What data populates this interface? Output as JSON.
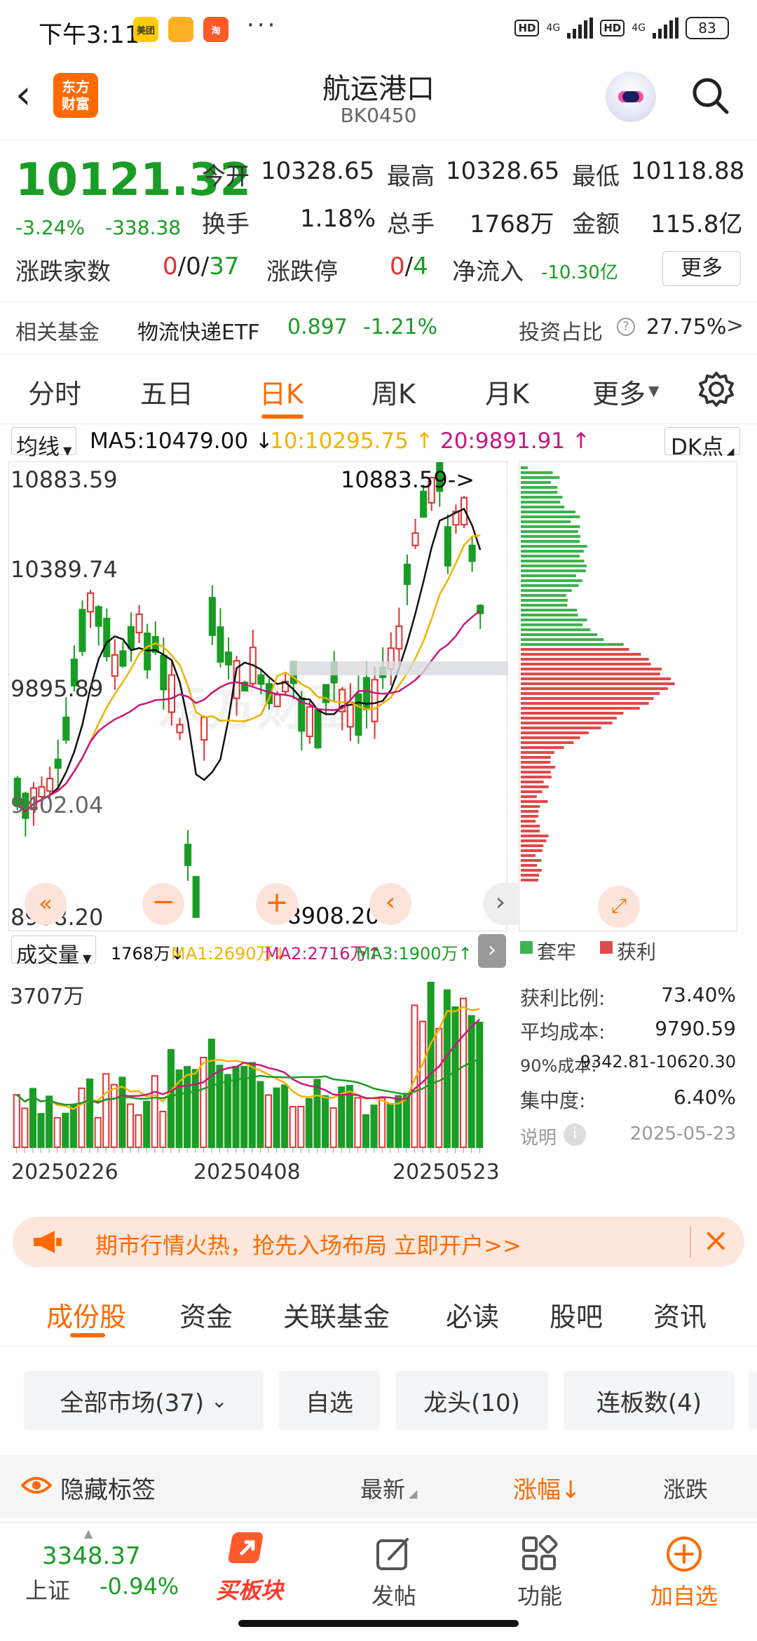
{
  "status": {
    "time": "下午3:11",
    "apps": [
      "美团",
      "",
      "淘"
    ],
    "net1": "4G",
    "net2": "4G",
    "hd": "HD",
    "battery": "83"
  },
  "header": {
    "title": "航运港口",
    "code": "BK0450",
    "logo_text": "东方财富"
  },
  "quote": {
    "price": "10121.32",
    "change_pct": "-3.24%",
    "change": "-338.38",
    "open_label": "今开",
    "open": "10328.65",
    "high_label": "最高",
    "high": "10328.65",
    "low_label": "最低",
    "low": "10118.88",
    "turnover_label": "换手",
    "turnover": "1.18%",
    "volume_label": "总手",
    "volume": "1768万",
    "amount_label": "金额",
    "amount": "115.8亿",
    "updown_label": "涨跌家数",
    "up": "0",
    "flat": "0",
    "down": "37",
    "limit_label": "涨跌停",
    "limit_up": "0",
    "limit_down": "4",
    "inflow_label": "净流入",
    "inflow": "-10.30亿",
    "more": "更多"
  },
  "fund": {
    "label": "相关基金",
    "name": "物流快递ETF",
    "price": "0.897",
    "pct": "-1.21%",
    "ratio_label": "投资占比",
    "ratio": "27.75%"
  },
  "period_tabs": [
    "分时",
    "五日",
    "日K",
    "周K",
    "月K",
    "更多"
  ],
  "ma": {
    "selector": "均线",
    "ma5": "MA5:10479.00",
    "ma5_arrow": "↓",
    "ma10": "10:10295.75",
    "ma10_arrow": "↑",
    "ma20": "20:9891.91",
    "ma20_arrow": "↑",
    "dk": "DK点"
  },
  "kchart": {
    "y_labels": [
      "10883.59",
      "10389.74",
      "9895.89",
      "9402.04",
      "8908.20"
    ],
    "max_note": "10883.59->",
    "min_note": "<-8908.20"
  },
  "vol": {
    "selector": "成交量",
    "v": "1768万",
    "v_arrow": "↓",
    "ma1": "MA1:2690万",
    "ma1_arrow": "↓",
    "ma2": "MA2:2716万",
    "ma2_arrow": "↑",
    "ma3": "MA3:1900万",
    "ma3_arrow": "↑",
    "ymax": "3707万",
    "dates": [
      "20250226",
      "20250408",
      "20250523"
    ]
  },
  "chip": {
    "legend_trapped": "套牢",
    "legend_profit": "获利",
    "profit_ratio_label": "获利比例:",
    "profit_ratio": "73.40%",
    "avg_cost_label": "平均成本:",
    "avg_cost": "9790.59",
    "cost90_label": "90%成本:",
    "cost90": "9342.81-10620.30",
    "concentration_label": "集中度:",
    "concentration": "6.40%",
    "note_label": "说明",
    "date": "2025-05-23"
  },
  "banner": {
    "text": "期市行情火热，抢先入场布局 立即开户>>"
  },
  "content_tabs": [
    "成份股",
    "资金",
    "关联基金",
    "必读",
    "股吧",
    "资讯"
  ],
  "chips": [
    "全部市场(37)",
    "自选",
    "龙头(10)",
    "连板数(4)"
  ],
  "list_header": {
    "hide": "隐藏标签",
    "latest": "最新",
    "pct": "涨幅",
    "pct_arrow": "↓",
    "change": "涨跌"
  },
  "bottom": {
    "index_value": "3348.37",
    "index_name": "上证",
    "index_pct": "-0.94%",
    "buy_block": "买板块",
    "post": "发帖",
    "func": "功能",
    "add": "加自选"
  },
  "colors": {
    "accent": "#ff6a00",
    "up": "#e53030",
    "down": "#1a9d25",
    "ma5": "#111111",
    "ma10": "#f0b400",
    "ma20": "#c8187e"
  }
}
